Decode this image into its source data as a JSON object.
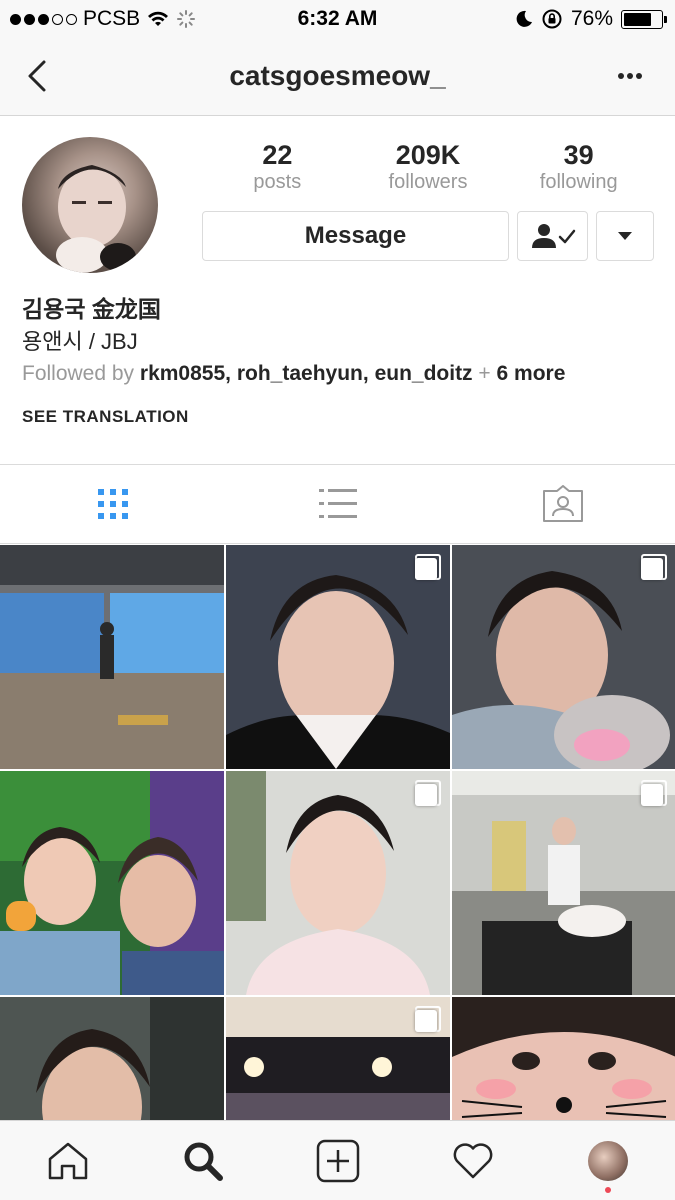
{
  "status_bar": {
    "carrier": "PCSB",
    "time": "6:32 AM",
    "battery": "76%",
    "battery_level": 0.76,
    "signal_bars_filled": 3,
    "signal_bars_total": 5
  },
  "nav": {
    "title": "catsgoesmeow_",
    "back_icon": "chevron-left-icon",
    "more_icon": "more-horizontal-icon"
  },
  "profile": {
    "stats": [
      {
        "value": "22",
        "label": "posts"
      },
      {
        "value": "209K",
        "label": "followers"
      },
      {
        "value": "39",
        "label": "following"
      }
    ],
    "message_label": "Message",
    "following_icon": "person-check-icon",
    "dropdown_icon": "caret-down-icon",
    "name": "김용국 金龙国",
    "bio": "용앤시 / JBJ",
    "followed_by_prefix": "Followed by",
    "followed_by_users": [
      "rkm0855",
      "roh_taehyun",
      "eun_doitz"
    ],
    "followed_by_more": "+ 6 more",
    "see_translation": "SEE TRANSLATION"
  },
  "tabs": [
    {
      "icon": "grid-icon",
      "active": true
    },
    {
      "icon": "list-icon",
      "active": false
    },
    {
      "icon": "tagged-icon",
      "active": false
    }
  ],
  "colors": {
    "accent": "#3897f0",
    "text": "#262626",
    "muted": "#999999",
    "notification": "#ed4956"
  },
  "bottom_nav": [
    {
      "icon": "home-icon"
    },
    {
      "icon": "search-icon",
      "active": true
    },
    {
      "icon": "add-post-icon"
    },
    {
      "icon": "heart-icon"
    },
    {
      "icon": "profile-avatar"
    }
  ]
}
